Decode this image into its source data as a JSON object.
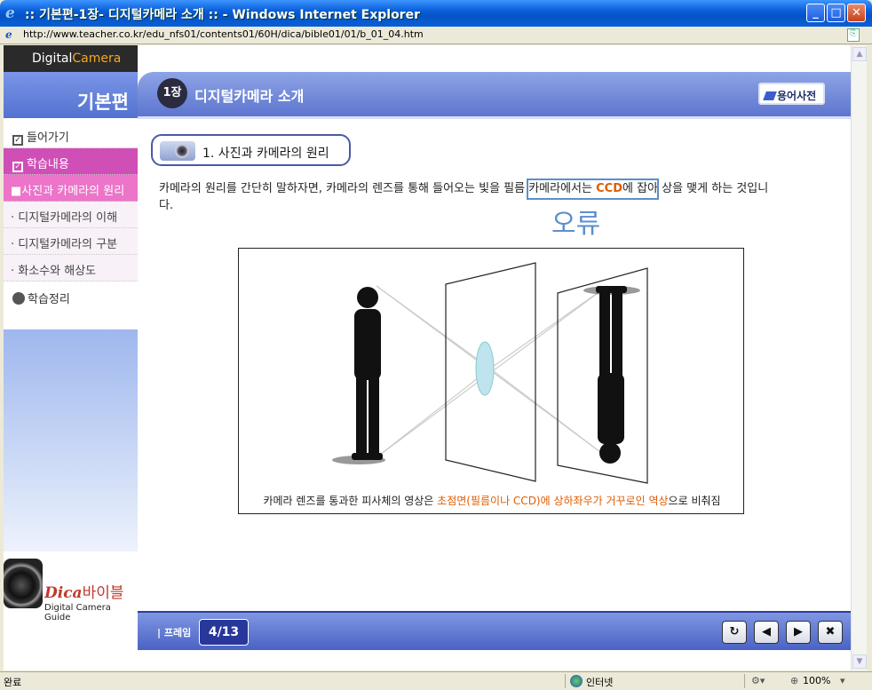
{
  "window": {
    "title": ":: 기본편-1장- 디지털카메라 소개 :: - Windows Internet Explorer",
    "min": "_",
    "max": "□",
    "close": "✕"
  },
  "address": {
    "url": "http://www.teacher.co.kr/edu_nfs01/contents01/60H/dica/bible01/01/b_01_04.htm"
  },
  "leftnav": {
    "brand_a": "Digital",
    "brand_b": "Camera",
    "section": "기본편",
    "items": [
      {
        "label": "들어가기"
      },
      {
        "label": "학습내용"
      },
      {
        "label": "■사진과 카메라의 원리"
      },
      {
        "label": "· 디지털카메라의 이해"
      },
      {
        "label": "· 디지털카메라의 구분"
      },
      {
        "label": "· 화소수와 해상도"
      },
      {
        "label": "학습정리"
      }
    ],
    "logo_dica": "Dica",
    "logo_bible": "바이블",
    "logo_guide": "Digital Camera Guide"
  },
  "chapter": {
    "badge": "1장",
    "title": "디지털카메라 소개",
    "dict_button": "용어사전"
  },
  "section": {
    "title": "1. 사진과 카메라의 원리"
  },
  "description": {
    "part1": "카메라의 원리를 간단히 말하자면, 카메라의 렌즈를 통해 들어오는 빛을 필름 카메라에서는 ",
    "ccd": "CCD",
    "part2": "에 잡아 상을 맺게 하는 것입니다."
  },
  "error_label": "오류",
  "figure": {
    "caption_a": "카메라 렌즈를 통과한 피사체의 영상은 ",
    "caption_b": "초점면(필름이나 CCD)에 상하좌우가 거꾸로인 역상",
    "caption_c": "으로 비춰짐"
  },
  "bottombar": {
    "frame_label": "| 프레임",
    "page": "4/13",
    "reload": "↻",
    "prev": "◀",
    "next": "▶",
    "exit": "✖"
  },
  "statusbar": {
    "done": "완료",
    "zone": "인터넷",
    "zoom": "100%"
  },
  "colors": {
    "accent": "#5d75cf",
    "highlight": "#e05c00",
    "menu_active": "#cf4fb6",
    "error": "#5b8fcc"
  }
}
